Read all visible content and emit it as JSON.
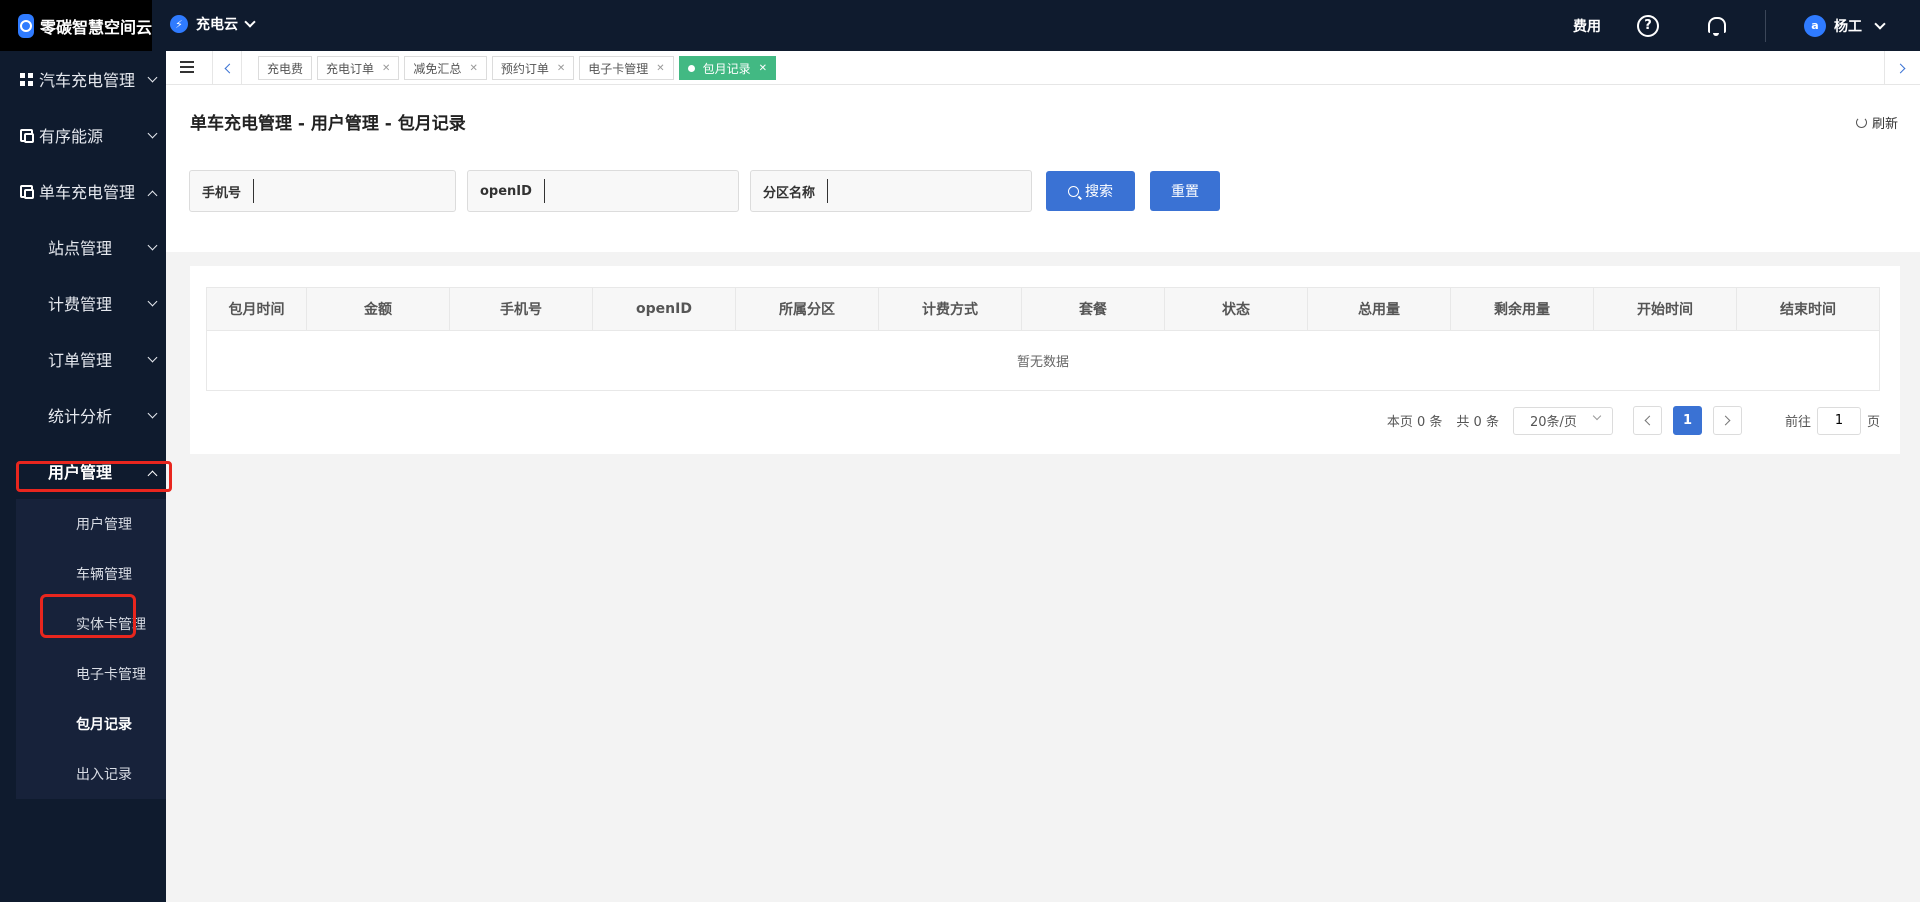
{
  "brand": {
    "title": "零碳智慧空间云"
  },
  "app_switch": {
    "name": "充电云",
    "icon": "app-logo-icon"
  },
  "header": {
    "fee_label": "费用",
    "user_name": "杨工",
    "avatar_text": "a"
  },
  "sidebar": {
    "items": [
      {
        "label": "汽车充电管理",
        "icon": "grid-icon"
      },
      {
        "label": "有序能源",
        "icon": "box-icon"
      },
      {
        "label": "单车充电管理",
        "icon": "box-icon"
      },
      {
        "label": "站点管理"
      },
      {
        "label": "计费管理"
      },
      {
        "label": "订单管理"
      },
      {
        "label": "统计分析"
      },
      {
        "label": "用户管理"
      }
    ],
    "submenu": [
      "用户管理",
      "车辆管理",
      "实体卡管理",
      "电子卡管理",
      "包月记录",
      "出入记录"
    ],
    "active_submenu": "包月记录"
  },
  "tabs": [
    {
      "label": "充电费",
      "closable": false
    },
    {
      "label": "充电订单",
      "closable": true
    },
    {
      "label": "减免汇总",
      "closable": true
    },
    {
      "label": "预约订单",
      "closable": true
    },
    {
      "label": "电子卡管理",
      "closable": true
    },
    {
      "label": "包月记录",
      "closable": true,
      "active": true
    }
  ],
  "page": {
    "title": "单车充电管理 - 用户管理 - 包月记录",
    "refresh_label": "刷新"
  },
  "filters": {
    "phone_label": "手机号",
    "openid_label": "openID",
    "region_label": "分区名称",
    "search_label": "搜索",
    "reset_label": "重置"
  },
  "table": {
    "columns": [
      "包月时间",
      "金额",
      "手机号",
      "openID",
      "所属分区",
      "计费方式",
      "套餐",
      "状态",
      "总用量",
      "剩余用量",
      "开始时间",
      "结束时间"
    ],
    "empty_text": "暂无数据"
  },
  "pagination": {
    "page_count_text": "本页 0 条",
    "total_text": "共 0 条",
    "page_size": "20条/页",
    "current_page": "1",
    "goto_prefix": "前往",
    "goto_value": "1",
    "goto_suffix": "页"
  },
  "colors": {
    "accent": "#3a72d4",
    "active_tab": "#42b983",
    "sidebar_bg": "#0f1b2e",
    "highlight": "#e8261e"
  }
}
